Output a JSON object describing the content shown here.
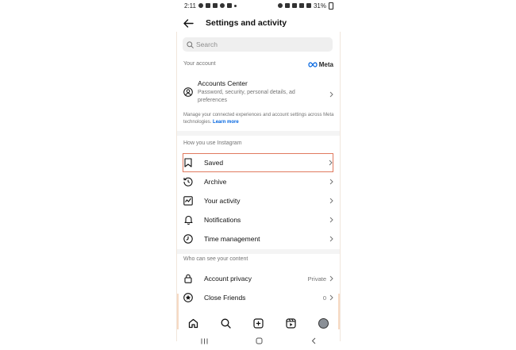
{
  "status_bar": {
    "time": "2:11",
    "battery": "31%"
  },
  "header": {
    "title": "Settings and activity"
  },
  "search": {
    "placeholder": "Search"
  },
  "your_account": {
    "header": "Your account",
    "meta_label": "Meta",
    "accounts_center": {
      "title": "Accounts Center",
      "subtitle": "Password, security, personal details, ad preferences"
    },
    "description": "Manage your connected experiences and account settings across Meta technologies.",
    "learn_more": "Learn more"
  },
  "how_you_use": {
    "header": "How you use Instagram",
    "items": [
      {
        "label": "Saved",
        "icon": "bookmark-icon"
      },
      {
        "label": "Archive",
        "icon": "archive-icon"
      },
      {
        "label": "Your activity",
        "icon": "activity-icon"
      },
      {
        "label": "Notifications",
        "icon": "bell-icon"
      },
      {
        "label": "Time management",
        "icon": "clock-icon"
      }
    ]
  },
  "who_can_see": {
    "header": "Who can see your content",
    "items": [
      {
        "label": "Account privacy",
        "value": "Private",
        "icon": "lock-icon"
      },
      {
        "label": "Close Friends",
        "value": "0",
        "icon": "star-icon"
      }
    ]
  },
  "bottom_nav": [
    "home-icon",
    "search-icon",
    "create-icon",
    "reels-icon",
    "profile-avatar"
  ],
  "colors": {
    "highlight": "#e07a5f",
    "link": "#0064e0"
  }
}
